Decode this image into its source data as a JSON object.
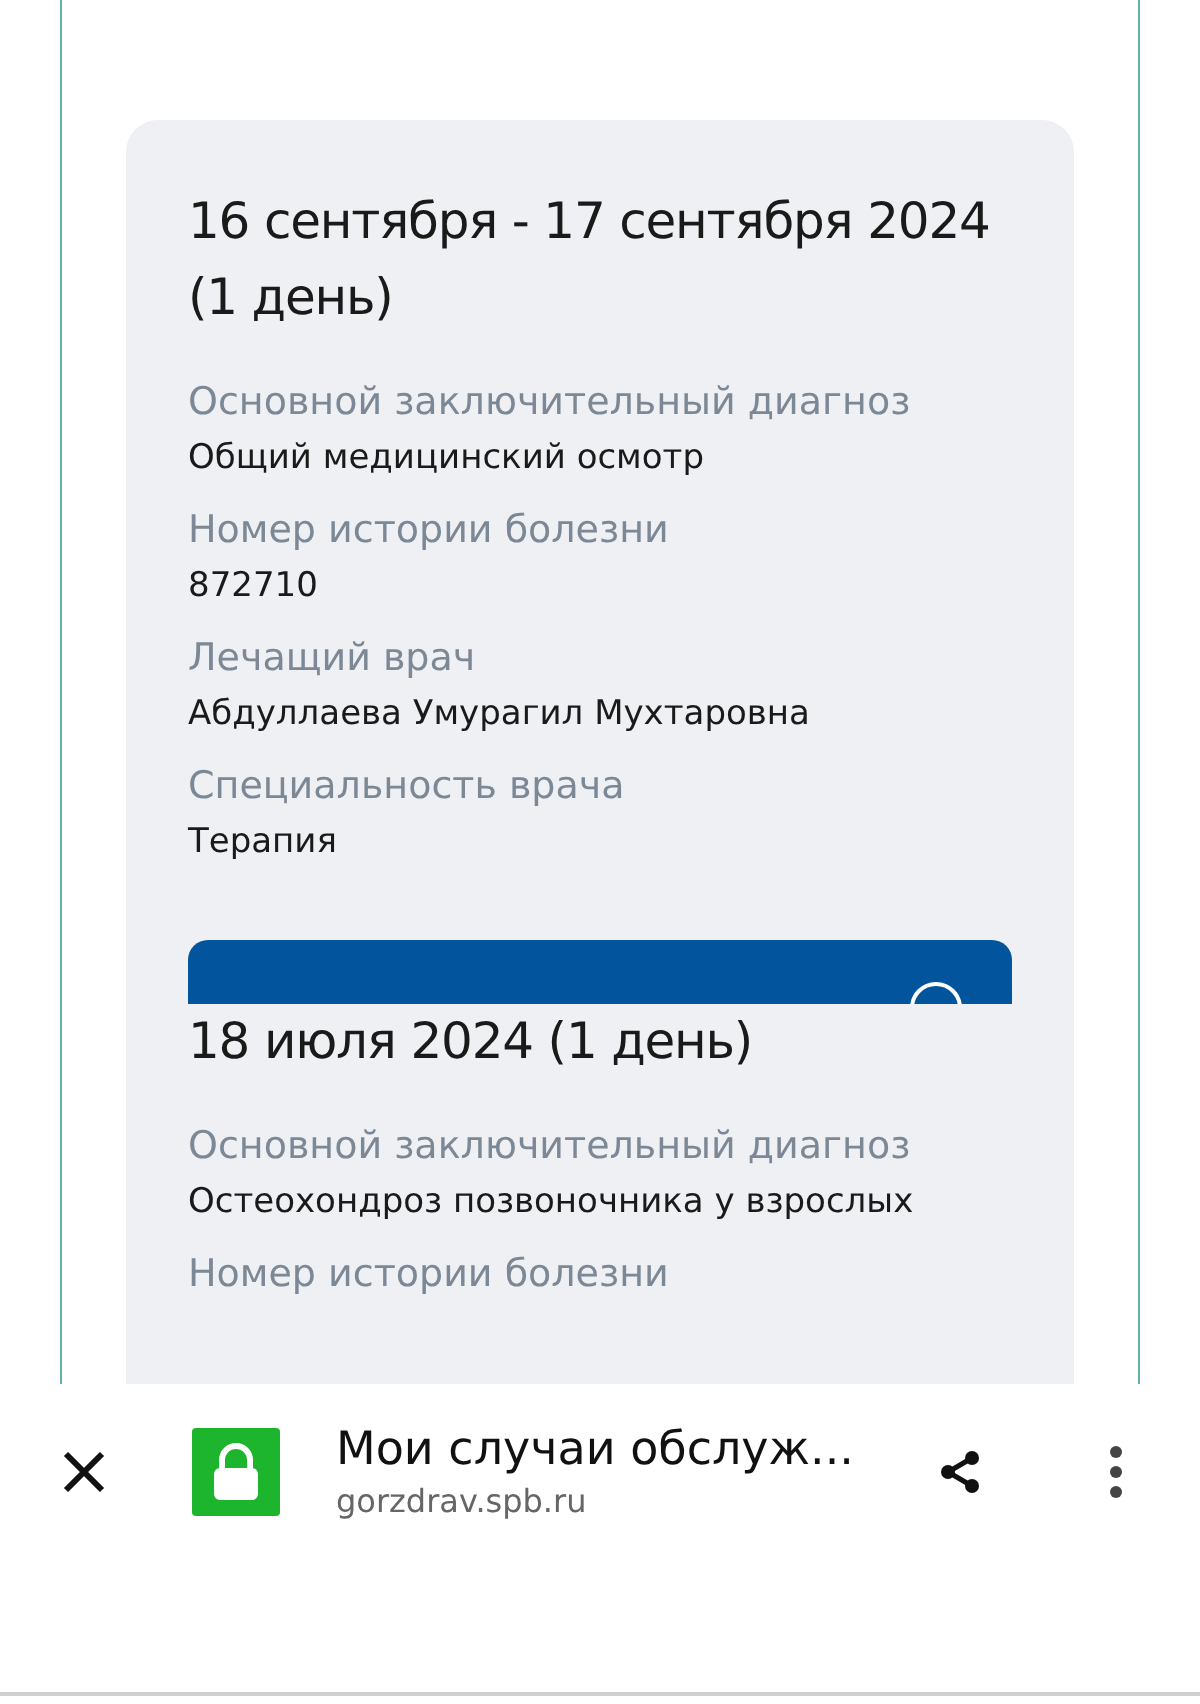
{
  "cases": [
    {
      "title": "16 сентября - 17 сентября 2024 (1 день)",
      "fields": [
        {
          "label": "Основной заключительный диагноз",
          "value": "Общий медицинский осмотр"
        },
        {
          "label": "Номер истории болезни",
          "value": "872710"
        },
        {
          "label": "Лечащий врач",
          "value": "Абдуллаева Умурагил Мухтаровна"
        },
        {
          "label": "Специальность врача",
          "value": "Терапия"
        }
      ],
      "has_button": true
    },
    {
      "title": "18 июля 2024 (1 день)",
      "fields": [
        {
          "label": "Основной заключительный диагноз",
          "value": "Остеохондроз позвоночника у взрослых"
        },
        {
          "label": "Номер истории болезни"
        }
      ],
      "has_button": false
    }
  ],
  "browser_bar": {
    "title": "Мои случаи обслуж...",
    "url": "gorzdrav.spb.ru",
    "secure": true
  }
}
